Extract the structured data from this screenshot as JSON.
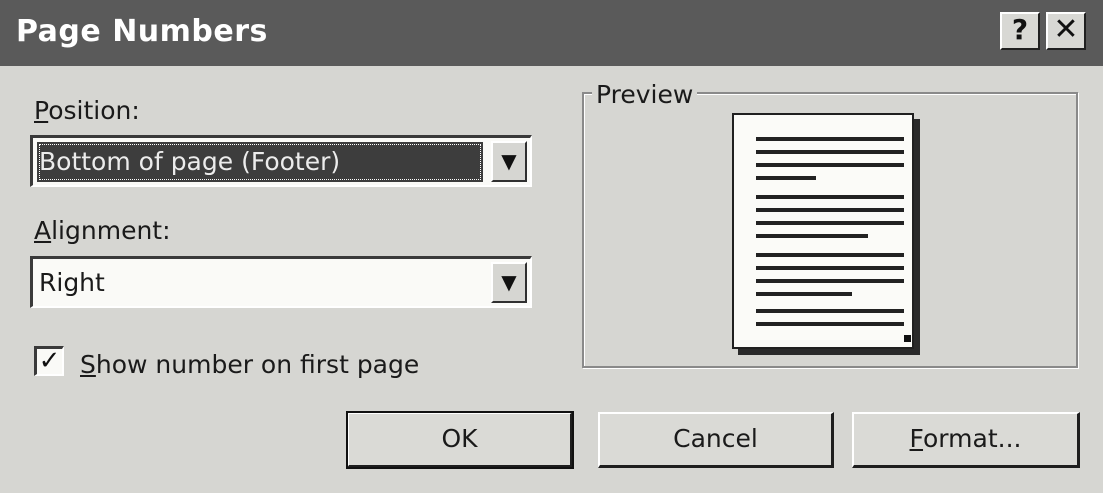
{
  "dialog": {
    "title": "Page Numbers",
    "help_button": "?",
    "close_button": "✕"
  },
  "position": {
    "label_accel": "P",
    "label_rest": "osition:",
    "value": "Bottom of page (Footer)"
  },
  "alignment": {
    "label_accel": "A",
    "label_rest": "lignment:",
    "value": "Right"
  },
  "first_page": {
    "checked": true,
    "label_accel": "S",
    "label_rest": "how number on first page"
  },
  "preview": {
    "legend": "Preview"
  },
  "buttons": {
    "ok": "OK",
    "cancel": "Cancel",
    "format_accel": "F",
    "format_rest": "ormat..."
  },
  "icons": {
    "dropdown": "chevron-down-icon",
    "check": "checkmark-icon"
  }
}
